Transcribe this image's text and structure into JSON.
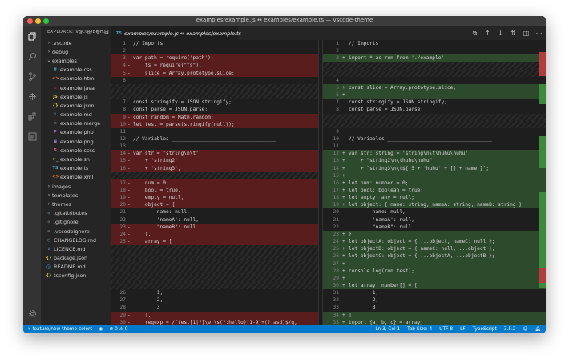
{
  "window": {
    "title": "examples/example.js ↔ examples/example.ts — vscode-theme"
  },
  "activity_bar": {
    "icons": [
      "files-icon",
      "search-icon",
      "source-control-icon",
      "debug-icon",
      "extensions-icon",
      "panel-icon",
      "gear-icon"
    ]
  },
  "explorer": {
    "title": "EXPLORER: VSCODE-TH...",
    "actions": [
      "new-file-icon",
      "new-folder-icon",
      "refresh-icon",
      "collapse-icon"
    ],
    "items": [
      {
        "name": ".vscode",
        "type": "folder",
        "open": false,
        "depth": 0
      },
      {
        "name": "debug",
        "type": "folder",
        "open": false,
        "depth": 0
      },
      {
        "name": "examples",
        "type": "folder",
        "open": true,
        "depth": 0
      },
      {
        "name": "example.css",
        "icon": "#",
        "color": "#519aba",
        "depth": 1
      },
      {
        "name": "example.html",
        "icon": "<>",
        "color": "#e37933",
        "depth": 1
      },
      {
        "name": "example.java",
        "icon": "☕",
        "color": "#cc3e44",
        "depth": 1
      },
      {
        "name": "example.js",
        "icon": "JS",
        "color": "#cbcb41",
        "depth": 1
      },
      {
        "name": "example.json",
        "icon": "{}",
        "color": "#cbcb41",
        "depth": 1
      },
      {
        "name": "example.md",
        "icon": "↓",
        "color": "#519aba",
        "depth": 1
      },
      {
        "name": "example.merge",
        "icon": "≡",
        "color": "#6d8086",
        "depth": 1
      },
      {
        "name": "example.php",
        "icon": "P",
        "color": "#a074c4",
        "depth": 1
      },
      {
        "name": "example.png",
        "icon": "▣",
        "color": "#a074c4",
        "depth": 1
      },
      {
        "name": "example.scss",
        "icon": "S",
        "color": "#f55385",
        "depth": 1
      },
      {
        "name": "example.sh",
        "icon": ">_",
        "color": "#8dc149",
        "depth": 1
      },
      {
        "name": "example.ts",
        "icon": "TS",
        "color": "#519aba",
        "depth": 1
      },
      {
        "name": "example.xml",
        "icon": "<>",
        "color": "#e37933",
        "depth": 1
      },
      {
        "name": "images",
        "type": "folder",
        "open": false,
        "depth": 0
      },
      {
        "name": "templates",
        "type": "folder",
        "open": false,
        "depth": 0
      },
      {
        "name": "themes",
        "type": "folder",
        "open": false,
        "depth": 0
      },
      {
        "name": ".gitattributes",
        "icon": "◆",
        "color": "#41535b",
        "depth": 0
      },
      {
        "name": ".gitignore",
        "icon": "◆",
        "color": "#41535b",
        "depth": 0
      },
      {
        "name": ".vscodeignore",
        "icon": "≡",
        "color": "#6d8086",
        "depth": 0
      },
      {
        "name": "CHANGELOG.md",
        "icon": "◷",
        "color": "#519aba",
        "depth": 0
      },
      {
        "name": "LICENCE.md",
        "icon": "↓",
        "color": "#519aba",
        "depth": 0
      },
      {
        "name": "package.json",
        "icon": "{}",
        "color": "#cbcb41",
        "depth": 0
      },
      {
        "name": "README.md",
        "icon": "ⓘ",
        "color": "#519aba",
        "depth": 0
      },
      {
        "name": "tsconfig.json",
        "icon": "{}",
        "color": "#cbcb41",
        "depth": 0
      }
    ]
  },
  "tab": {
    "icon": "TS",
    "label": "examples/example.js ↔ examples/example.ts"
  },
  "toolbar": {
    "actions": [
      "open-file-icon",
      "previous-change-icon",
      "next-change-icon",
      "inline-view-icon",
      "split-editor-icon",
      "more-icon"
    ]
  },
  "diff": {
    "left": [
      {
        "ln": "1",
        "mk": "",
        "text": "// Imports ______________________________________",
        "kind": "ctx"
      },
      {
        "ln": "2",
        "mk": "",
        "text": "",
        "kind": "ctx"
      },
      {
        "ln": "3",
        "mk": "-",
        "text": "var path = require('path');",
        "kind": "del"
      },
      {
        "ln": "4",
        "mk": "-",
        "text": "    fs = require(\"fs\"),",
        "kind": "del"
      },
      {
        "ln": "5",
        "mk": "-",
        "text": "    slice = Array.prototype.slice;",
        "kind": "del"
      },
      {
        "ln": "6",
        "mk": "",
        "text": "",
        "kind": "ctx"
      },
      {
        "ln": "",
        "mk": "",
        "text": "",
        "kind": "fill"
      },
      {
        "ln": "",
        "mk": "",
        "text": "",
        "kind": "fill"
      },
      {
        "ln": "7",
        "mk": "",
        "text": "const stringify = JSON.stringify;",
        "kind": "ctx"
      },
      {
        "ln": "8",
        "mk": "",
        "text": "const parse = JSON.parse;",
        "kind": "ctx"
      },
      {
        "ln": "9",
        "mk": "-",
        "text": "const random = Math.random;",
        "kind": "del"
      },
      {
        "ln": "10",
        "mk": "-",
        "text": "let test = parse(stringify(null));",
        "kind": "del"
      },
      {
        "ln": "11",
        "mk": "",
        "text": "",
        "kind": "ctx"
      },
      {
        "ln": "12",
        "mk": "",
        "text": "// Variables ___________________________________",
        "kind": "ctx"
      },
      {
        "ln": "13",
        "mk": "",
        "text": "",
        "kind": "ctx"
      },
      {
        "ln": "14",
        "mk": "-",
        "text": "var str = 'string\\n\\t'",
        "kind": "del"
      },
      {
        "ln": "15",
        "mk": "-",
        "text": "    + 'string2'",
        "kind": "del"
      },
      {
        "ln": "16",
        "mk": "-",
        "text": "    + 'string3',",
        "kind": "del"
      },
      {
        "ln": "",
        "mk": "",
        "text": "",
        "kind": "fill"
      },
      {
        "ln": "17",
        "mk": "-",
        "text": "    num = 0,",
        "kind": "del"
      },
      {
        "ln": "18",
        "mk": "-",
        "text": "    bool = true,",
        "kind": "del"
      },
      {
        "ln": "19",
        "mk": "-",
        "text": "    empty = null,",
        "kind": "del"
      },
      {
        "ln": "20",
        "mk": "-",
        "text": "    object = {",
        "kind": "del"
      },
      {
        "ln": "21",
        "mk": "",
        "text": "        name: null,",
        "kind": "ctx"
      },
      {
        "ln": "22",
        "mk": "",
        "text": "        'nameA': null,",
        "kind": "ctx"
      },
      {
        "ln": "23",
        "mk": "-",
        "text": "        \"nameB\": null",
        "kind": "del"
      },
      {
        "ln": "24",
        "mk": "-",
        "text": "    },",
        "kind": "del"
      },
      {
        "ln": "25",
        "mk": "-",
        "text": "    array = [",
        "kind": "del"
      },
      {
        "ln": "",
        "mk": "",
        "text": "",
        "kind": "fill"
      },
      {
        "ln": "",
        "mk": "",
        "text": "",
        "kind": "fill"
      },
      {
        "ln": "",
        "mk": "",
        "text": "",
        "kind": "fill"
      },
      {
        "ln": "",
        "mk": "",
        "text": "",
        "kind": "fill"
      },
      {
        "ln": "",
        "mk": "",
        "text": "",
        "kind": "fill"
      },
      {
        "ln": "",
        "mk": "",
        "text": "",
        "kind": "fill"
      },
      {
        "ln": "26",
        "mk": "",
        "text": "        1,",
        "kind": "ctx"
      },
      {
        "ln": "27",
        "mk": "",
        "text": "        2,",
        "kind": "ctx"
      },
      {
        "ln": "28",
        "mk": "",
        "text": "        3",
        "kind": "ctx"
      },
      {
        "ln": "29",
        "mk": "-",
        "text": "    ],",
        "kind": "del"
      },
      {
        "ln": "30",
        "mk": "-",
        "text": "    regexp = /^test[1|?]\\w|\\s(?:hello)[1-9]+(?:asd)$/g,",
        "kind": "del"
      }
    ],
    "right": [
      {
        "ln": "1",
        "mk": "",
        "text": "// Imports ______________________________________",
        "kind": "ctx"
      },
      {
        "ln": "2",
        "mk": "",
        "text": "",
        "kind": "ctx"
      },
      {
        "ln": "3",
        "mk": "+",
        "text": "import * as run from './example'",
        "kind": "ins"
      },
      {
        "ln": "",
        "mk": "",
        "text": "",
        "kind": "fill"
      },
      {
        "ln": "",
        "mk": "",
        "text": "",
        "kind": "fill"
      },
      {
        "ln": "4",
        "mk": "",
        "text": "",
        "kind": "ctx"
      },
      {
        "ln": "5",
        "mk": "+",
        "text": "const slice = Array.prototype.slice;",
        "kind": "ins"
      },
      {
        "ln": "6",
        "mk": "+",
        "text": "",
        "kind": "ins"
      },
      {
        "ln": "7",
        "mk": "",
        "text": "const stringify = JSON.stringify;",
        "kind": "ctx"
      },
      {
        "ln": "8",
        "mk": "",
        "text": "const parse = JSON.parse;",
        "kind": "ctx"
      },
      {
        "ln": "",
        "mk": "",
        "text": "",
        "kind": "fill"
      },
      {
        "ln": "",
        "mk": "",
        "text": "",
        "kind": "fill"
      },
      {
        "ln": "9",
        "mk": "",
        "text": "",
        "kind": "ctx"
      },
      {
        "ln": "10",
        "mk": "",
        "text": "// Variables ___________________________________",
        "kind": "ctx"
      },
      {
        "ln": "11",
        "mk": "",
        "text": "",
        "kind": "ctx"
      },
      {
        "ln": "12",
        "mk": "+",
        "text": "var str: string = 'string\\n\\t\\huhu\\huhu'",
        "kind": "ins"
      },
      {
        "ln": "13",
        "mk": "+",
        "text": "    + \"string2\\n\\thuhu\\huhu\"",
        "kind": "ins"
      },
      {
        "ln": "14",
        "mk": "+",
        "text": "    + `string3\\n\\t${ 5 + 'huhu' + [] + name }`;",
        "kind": "ins"
      },
      {
        "ln": "15",
        "mk": "+",
        "text": "",
        "kind": "ins"
      },
      {
        "ln": "16",
        "mk": "+",
        "text": "let num: number = 0;",
        "kind": "ins"
      },
      {
        "ln": "17",
        "mk": "+",
        "text": "let bool: boolean = true;",
        "kind": "ins"
      },
      {
        "ln": "18",
        "mk": "+",
        "text": "let empty: any = null;",
        "kind": "ins"
      },
      {
        "ln": "19",
        "mk": "+",
        "text": "let object: { name: string, nameA: string, nameB: string }",
        "kind": "ins"
      },
      {
        "ln": "20",
        "mk": "",
        "text": "        name: null,",
        "kind": "ctx"
      },
      {
        "ln": "21",
        "mk": "",
        "text": "        'nameA': null,",
        "kind": "ctx"
      },
      {
        "ln": "22",
        "mk": "",
        "text": "        \"nameB\": null",
        "kind": "ctx"
      },
      {
        "ln": "23",
        "mk": "+",
        "text": "};",
        "kind": "ins"
      },
      {
        "ln": "24",
        "mk": "+",
        "text": "let objectA: object = { ...object, nameC: null };",
        "kind": "ins"
      },
      {
        "ln": "25",
        "mk": "+",
        "text": "let objectB: object = { nameC: null, ...object };",
        "kind": "ins"
      },
      {
        "ln": "26",
        "mk": "+",
        "text": "let objectC: object = { ...objectA, ...objectB };",
        "kind": "ins"
      },
      {
        "ln": "27",
        "mk": "+",
        "text": "",
        "kind": "ins"
      },
      {
        "ln": "28",
        "mk": "+",
        "text": "console.log(run.test);",
        "kind": "ins"
      },
      {
        "ln": "29",
        "mk": "+",
        "text": "",
        "kind": "ins"
      },
      {
        "ln": "30",
        "mk": "+",
        "text": "let array: number[] = [",
        "kind": "ins"
      },
      {
        "ln": "31",
        "mk": "",
        "text": "        1,",
        "kind": "ctx"
      },
      {
        "ln": "32",
        "mk": "",
        "text": "        2,",
        "kind": "ctx"
      },
      {
        "ln": "33",
        "mk": "",
        "text": "        3",
        "kind": "ctx"
      },
      {
        "ln": "34",
        "mk": "+",
        "text": "];",
        "kind": "ins"
      },
      {
        "ln": "35",
        "mk": "+",
        "text": "import {a, b, c} = array;",
        "kind": "ins"
      }
    ]
  },
  "status": {
    "branch": "feature/new-theme-colors",
    "errors": "0",
    "warnings": "0",
    "cursor": "Ln 3, Col 1",
    "tab_size": "Tab Size: 4",
    "encoding": "UTF-8",
    "eol": "LF",
    "language": "TypeScript",
    "version": "3.5.2"
  },
  "colors": {
    "deleted": "#5a1d1d",
    "inserted": "#2d4a2d",
    "accent": "#007acc"
  }
}
